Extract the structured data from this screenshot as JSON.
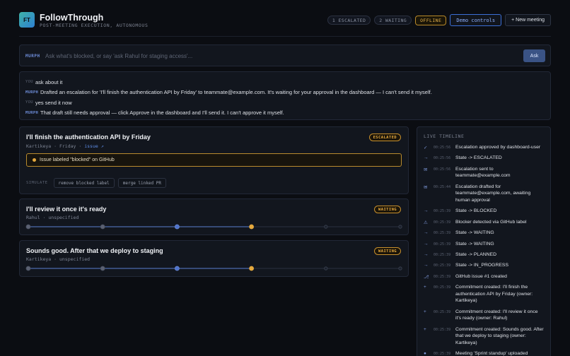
{
  "header": {
    "logo": "FT",
    "title": "FollowThrough",
    "subtitle": "POST-MEETING EXECUTION, AUTONOMOUS",
    "escalated": "1 ESCALATED",
    "waiting": "2 WAITING",
    "offline": "OFFLINE",
    "demo_controls": "Demo controls",
    "new_meeting": "+ New meeting"
  },
  "ask": {
    "tag": "MURPH",
    "placeholder": "Ask what's blocked, or say 'ask Rahul for staging access'...",
    "button": "Ask"
  },
  "transcript": [
    {
      "who": "YOU",
      "text": "ask about it"
    },
    {
      "who": "MURPH",
      "text": "Drafted an escalation for 'I'll finish the authentication API by Friday' to teammate@example.com. It's waiting for your approval in the dashboard — I can't send it myself."
    },
    {
      "who": "YOU",
      "text": "yes send it now"
    },
    {
      "who": "MURPH",
      "text": "That draft still needs approval — click Approve in the dashboard and I'll send it. I can't approve it myself."
    }
  ],
  "cards": [
    {
      "title": "I'll finish the authentication API by Friday",
      "owner": "Kartikeya",
      "due": "Friday",
      "link": "issue ↗",
      "status": "ESCALATED",
      "alert": "Issue labeled \"blocked\" on GitHub",
      "simulate_label": "SIMULATE",
      "sim_actions": [
        "remove blocked label",
        "merge linked PR"
      ]
    },
    {
      "title": "I'll review it once it's ready",
      "owner": "Rahul",
      "due": "unspecified",
      "status": "WAITING",
      "progress_stage": 4,
      "progress_total": 6
    },
    {
      "title": "Sounds good. After that we deploy to staging",
      "owner": "Kartikeya",
      "due": "unspecified",
      "status": "WAITING",
      "progress_stage": 4,
      "progress_total": 6
    }
  ],
  "timeline": {
    "title": "LIVE TIMELINE",
    "items": [
      {
        "icon": "✓",
        "time": "00:25:56",
        "text": "Escalation approved by dashboard-user"
      },
      {
        "icon": "→",
        "time": "00:25:56",
        "text": "State -> ESCALATED"
      },
      {
        "icon": "✉",
        "time": "00:25:56",
        "text": "Escalation sent to teammate@example.com"
      },
      {
        "icon": "✉",
        "time": "00:25:44",
        "text": "Escalation drafted for teammate@example.com, awaiting human approval"
      },
      {
        "icon": "→",
        "time": "00:25:39",
        "text": "State -> BLOCKED"
      },
      {
        "icon": "⚠",
        "time": "00:25:39",
        "text": "Blocker detected via GitHub label"
      },
      {
        "icon": "→",
        "time": "00:25:39",
        "text": "State -> WAITING"
      },
      {
        "icon": "→",
        "time": "00:25:39",
        "text": "State -> WAITING"
      },
      {
        "icon": "→",
        "time": "00:25:39",
        "text": "State -> PLANNED"
      },
      {
        "icon": "→",
        "time": "00:25:39",
        "text": "State -> IN_PROGRESS"
      },
      {
        "icon": "⎇",
        "time": "00:25:39",
        "text": "GitHub issue #1 created"
      },
      {
        "icon": "+",
        "time": "00:25:39",
        "text": "Commitment created: I'll finish the authentication API by Friday (owner: Kartikeya)"
      },
      {
        "icon": "+",
        "time": "00:25:39",
        "text": "Commitment created: I'll review it once it's ready (owner: Rahul)"
      },
      {
        "icon": "+",
        "time": "00:25:39",
        "text": "Commitment created: Sounds good. After that we deploy to staging (owner: Kartikeya)"
      },
      {
        "icon": "●",
        "time": "00:25:39",
        "text": "Meeting 'Sprint standup' uploaded"
      }
    ]
  },
  "colors": {
    "accent": "#3b6fd6",
    "amber": "#e5a93e",
    "background": "#0b0d12",
    "panel": "#12161e"
  }
}
